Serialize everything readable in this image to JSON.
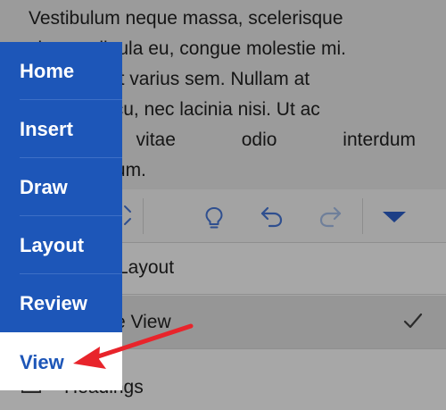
{
  "document": {
    "lines": [
      "Vestibulum neque massa, scelerisque",
      "sit amet ligula eu, congue molestie mi.",
      "Praesent ut varius sem. Nullam at",
      "porttitor arcu, nec lacinia nisi. Ut ac",
      "dolor vitae odio interdum",
      "condimentum."
    ]
  },
  "toolbar": {
    "icons": [
      "format-icon",
      "lightbulb-icon",
      "undo-icon",
      "redo-icon",
      "collapse-triangle-icon"
    ]
  },
  "view_menu": {
    "items": [
      {
        "label": "Layout",
        "selected": false
      },
      {
        "label": "e View",
        "selected": true,
        "checked": true
      },
      {
        "label": "Headings",
        "selected": false
      }
    ]
  },
  "side_nav": {
    "items": [
      {
        "label": "Home",
        "active": false
      },
      {
        "label": "Insert",
        "active": false
      },
      {
        "label": "Draw",
        "active": false
      },
      {
        "label": "Layout",
        "active": false
      },
      {
        "label": "Review",
        "active": false
      },
      {
        "label": "View",
        "active": true
      }
    ]
  },
  "colors": {
    "nav_blue": "#1d56b8",
    "arrow_red": "#e8242b",
    "dim_overlay": "#9b9b9b"
  }
}
